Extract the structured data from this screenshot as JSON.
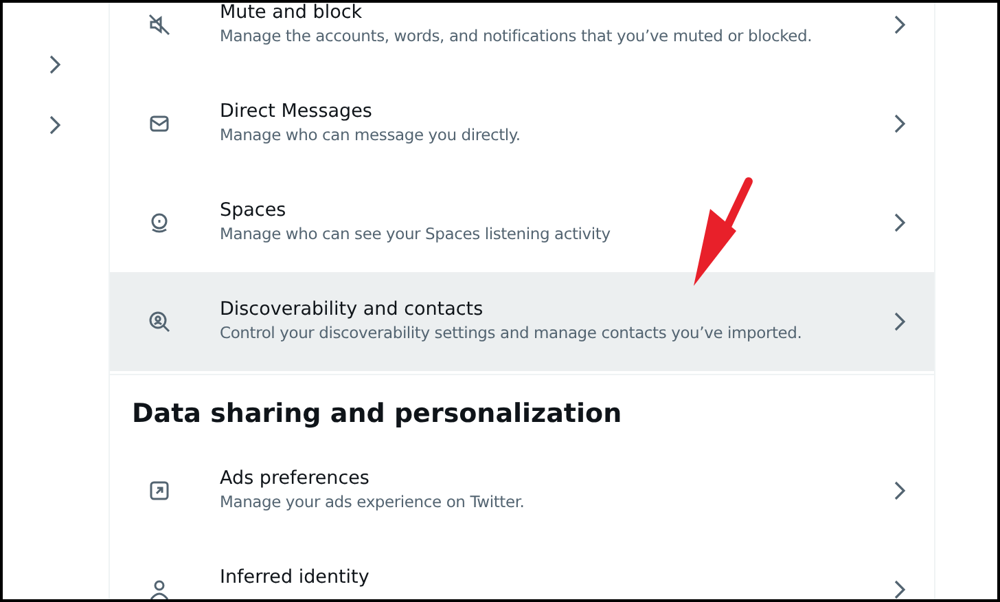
{
  "sections": [
    {
      "kind": "list",
      "items": [
        {
          "kind": "mute",
          "title": "Mute and block",
          "description": "Manage the accounts, words, and notifications that you’ve muted or blocked.",
          "highlighted": false
        },
        {
          "kind": "mail",
          "title": "Direct Messages",
          "description": "Manage who can message you directly.",
          "highlighted": false
        },
        {
          "kind": "spaces",
          "title": "Spaces",
          "description": "Manage who can see your Spaces listening activity",
          "highlighted": false
        },
        {
          "kind": "discover",
          "title": "Discoverability and contacts",
          "description": "Control your discoverability settings and manage contacts you’ve imported.",
          "highlighted": true
        }
      ]
    },
    {
      "kind": "list",
      "heading": "Data sharing and personalization",
      "items": [
        {
          "kind": "ads",
          "title": "Ads preferences",
          "description": "Manage your ads experience on Twitter.",
          "highlighted": false
        },
        {
          "kind": "identity",
          "title": "Inferred identity",
          "highlighted": false
        }
      ]
    }
  ]
}
